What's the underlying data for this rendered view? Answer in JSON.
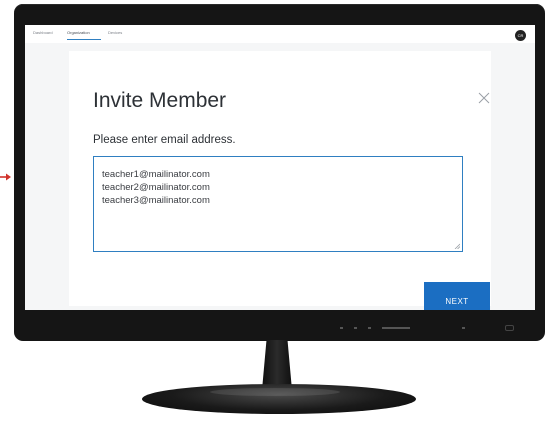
{
  "nav": {
    "tabs": [
      "Dashboard",
      "Organization",
      "Devices"
    ],
    "avatar_initials": "CR"
  },
  "modal": {
    "title": "Invite Member",
    "prompt": "Please enter email address.",
    "emails": [
      "teacher1@mailinator.com",
      "teacher2@mailinator.com",
      "teacher3@mailinator.com"
    ],
    "next_label": "NEXT"
  },
  "colors": {
    "accent": "#1b6ec2",
    "bezel": "#151515",
    "arrow": "#d0322b"
  }
}
